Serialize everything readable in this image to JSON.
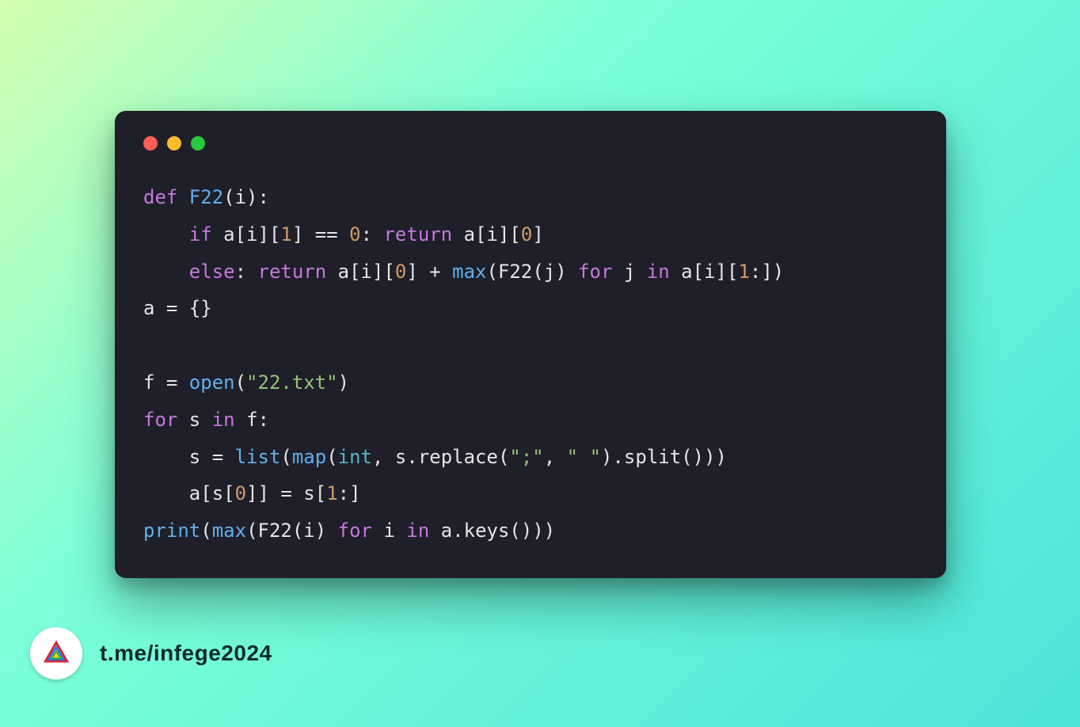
{
  "footer": {
    "link": "t.me/infege2024"
  },
  "code": {
    "tokens": [
      [
        [
          "def ",
          "kw"
        ],
        [
          "F22",
          "fn"
        ],
        [
          "(i):",
          ""
        ]
      ],
      [
        [
          "    ",
          ""
        ],
        [
          "if",
          "kw"
        ],
        [
          " a[i][",
          ""
        ],
        [
          "1",
          "num"
        ],
        [
          "] == ",
          ""
        ],
        [
          "0",
          "num"
        ],
        [
          ": ",
          ""
        ],
        [
          "return",
          "kw"
        ],
        [
          " a[i][",
          ""
        ],
        [
          "0",
          "num"
        ],
        [
          "]",
          ""
        ]
      ],
      [
        [
          "    ",
          ""
        ],
        [
          "else",
          "kw"
        ],
        [
          ": ",
          ""
        ],
        [
          "return",
          "kw"
        ],
        [
          " a[i][",
          ""
        ],
        [
          "0",
          "num"
        ],
        [
          "] + ",
          ""
        ],
        [
          "max",
          "fn"
        ],
        [
          "(F22(j) ",
          ""
        ],
        [
          "for",
          "kw"
        ],
        [
          " j ",
          ""
        ],
        [
          "in",
          "kw"
        ],
        [
          " a[i][",
          ""
        ],
        [
          "1",
          "num"
        ],
        [
          ":])",
          ""
        ]
      ],
      [
        [
          "a = {}",
          ""
        ]
      ],
      [
        [
          "",
          ""
        ]
      ],
      [
        [
          "f = ",
          ""
        ],
        [
          "open",
          "fn"
        ],
        [
          "(",
          ""
        ],
        [
          "\"22.txt\"",
          "str"
        ],
        [
          ")",
          ""
        ]
      ],
      [
        [
          "for",
          "kw"
        ],
        [
          " s ",
          ""
        ],
        [
          "in",
          "kw"
        ],
        [
          " f:",
          ""
        ]
      ],
      [
        [
          "    s = ",
          ""
        ],
        [
          "list",
          "fn"
        ],
        [
          "(",
          ""
        ],
        [
          "map",
          "fn"
        ],
        [
          "(",
          ""
        ],
        [
          "int",
          "builtin"
        ],
        [
          ", s.replace(",
          ""
        ],
        [
          "\";\"",
          "str"
        ],
        [
          ", ",
          ""
        ],
        [
          "\" \"",
          "str"
        ],
        [
          ").split()))",
          ""
        ]
      ],
      [
        [
          "    a[s[",
          ""
        ],
        [
          "0",
          "num"
        ],
        [
          "]] = s[",
          ""
        ],
        [
          "1",
          "num"
        ],
        [
          ":]",
          ""
        ]
      ],
      [
        [
          "print",
          "fn"
        ],
        [
          "(",
          ""
        ],
        [
          "max",
          "fn"
        ],
        [
          "(F22(i) ",
          ""
        ],
        [
          "for",
          "kw"
        ],
        [
          " i ",
          ""
        ],
        [
          "in",
          "kw"
        ],
        [
          " a.keys()))",
          ""
        ]
      ]
    ]
  }
}
